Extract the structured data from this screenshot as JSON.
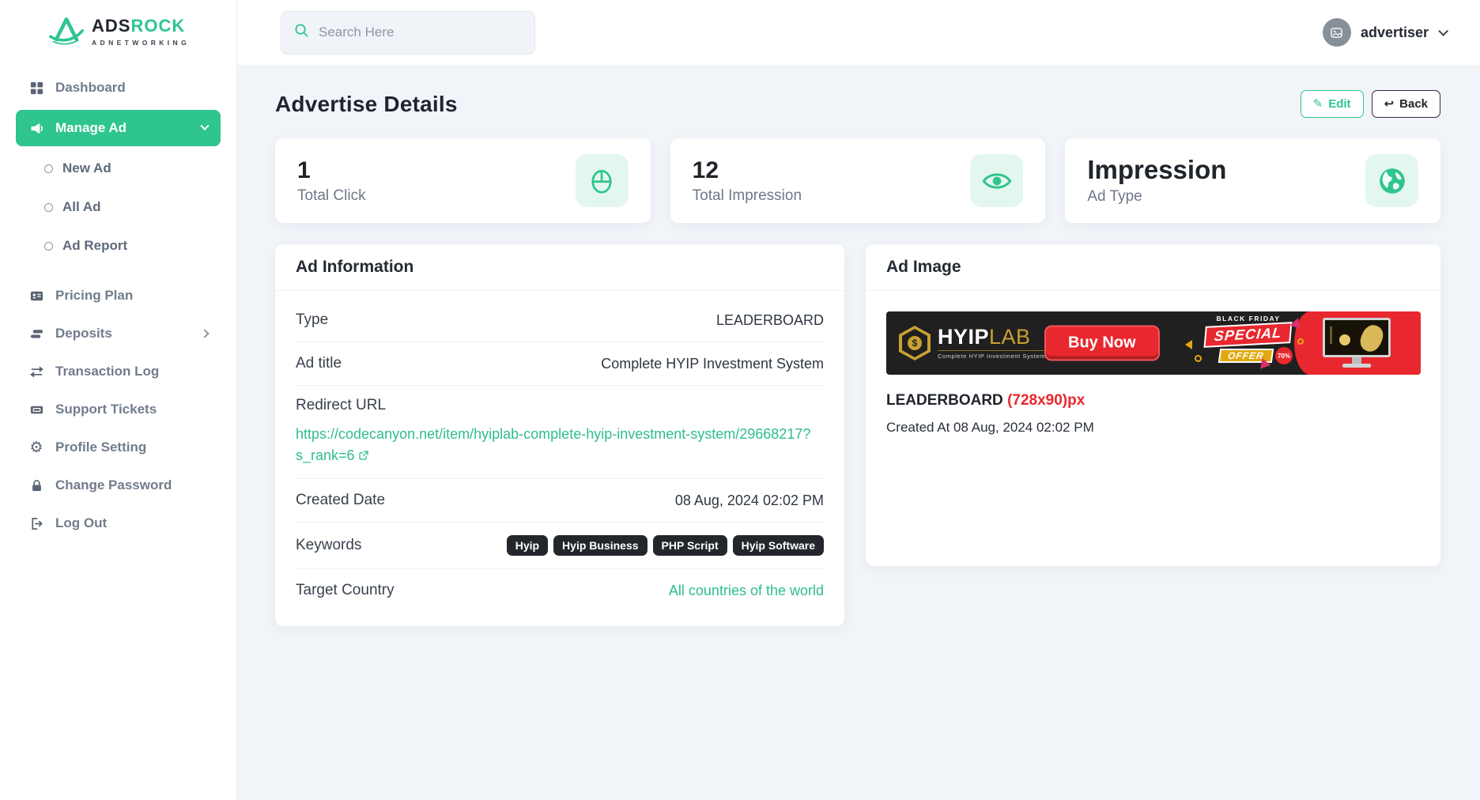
{
  "brand": {
    "name_primary": "ADS",
    "name_secondary": "ROCK",
    "tagline": "ADNETWORKING"
  },
  "header": {
    "search_placeholder": "Search Here",
    "user_name": "advertiser"
  },
  "sidebar": {
    "items": [
      {
        "label": "Dashboard",
        "icon": "grid-icon"
      },
      {
        "label": "Manage Ad",
        "icon": "megaphone-icon",
        "active": true
      },
      {
        "label": "New Ad",
        "icon": "circle-icon"
      },
      {
        "label": "All Ad",
        "icon": "circle-icon"
      },
      {
        "label": "Ad Report",
        "icon": "circle-icon"
      },
      {
        "label": "Pricing Plan",
        "icon": "id-card-icon"
      },
      {
        "label": "Deposits",
        "icon": "deposits-icon"
      },
      {
        "label": "Transaction Log",
        "icon": "transfer-icon"
      },
      {
        "label": "Support Tickets",
        "icon": "ticket-icon"
      },
      {
        "label": "Profile Setting",
        "icon": "gear-icon"
      },
      {
        "label": "Change Password",
        "icon": "lock-icon"
      },
      {
        "label": "Log Out",
        "icon": "logout-icon"
      }
    ]
  },
  "page": {
    "title": "Advertise Details",
    "edit_label": "Edit",
    "back_label": "Back"
  },
  "stats": [
    {
      "value": "1",
      "label": "Total Click",
      "icon": "mouse-icon"
    },
    {
      "value": "12",
      "label": "Total Impression",
      "icon": "eye-icon"
    },
    {
      "value": "Impression",
      "label": "Ad Type",
      "icon": "globe-icon"
    }
  ],
  "ad_information": {
    "panel_title": "Ad Information",
    "type_label": "Type",
    "type_value": "LEADERBOARD",
    "title_label": "Ad title",
    "title_value": "Complete HYIP Investment System",
    "redirect_label": "Redirect URL",
    "redirect_url": "https://codecanyon.net/item/hyiplab-complete-hyip-investment-system/29668217?s_rank=6",
    "created_label": "Created Date",
    "created_value": "08 Aug, 2024 02:02 PM",
    "keywords_label": "Keywords",
    "keywords": [
      "Hyip",
      "Hyip Business",
      "PHP Script",
      "Hyip Software"
    ],
    "country_label": "Target Country",
    "country_value": "All countries of the world"
  },
  "ad_image": {
    "panel_title": "Ad Image",
    "type_value": "LEADERBOARD",
    "size_value": "(728x90)px",
    "created_at": "Created At 08 Aug, 2024 02:02 PM",
    "banner": {
      "brand_hyip": "HYIP",
      "brand_lab": "LAB",
      "dollar": "$",
      "tagline": "Complete HYIP Investment System",
      "cta": "Buy Now",
      "black_friday": "BLACK FRIDAY",
      "special": "SPECIAL",
      "offer": "OFFER",
      "discount": "70%"
    }
  },
  "colors": {
    "accent": "#2EC58F",
    "accent_light": "#E4F7EF",
    "link": "#2EBD90",
    "red": "#E8262D",
    "badge_dark": "#23272C",
    "content_bg": "#F1F4F9"
  }
}
